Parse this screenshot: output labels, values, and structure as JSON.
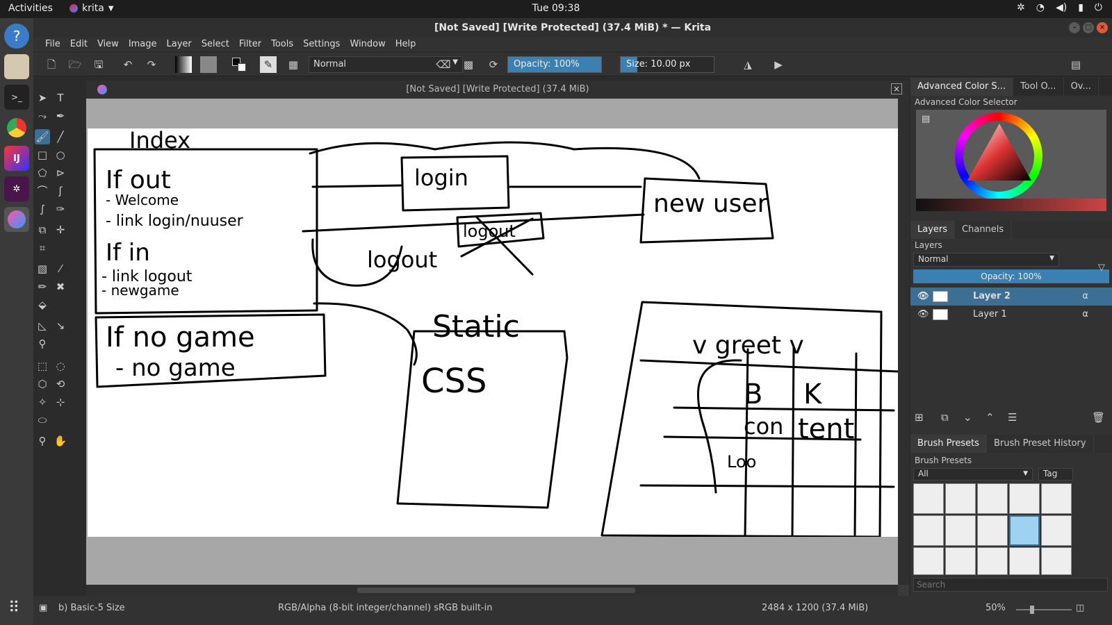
{
  "topbar": {
    "activities": "Activities",
    "app": "krita",
    "clock": "Tue 09:38"
  },
  "window": {
    "title": "[Not Saved]  [Write Protected]  (37.4 MiB) * — Krita"
  },
  "menu": [
    "File",
    "Edit",
    "View",
    "Image",
    "Layer",
    "Select",
    "Filter",
    "Tools",
    "Settings",
    "Window",
    "Help"
  ],
  "toolbar": {
    "blend_mode": "Normal",
    "opacity": "Opacity:  100%",
    "size": "Size:  10.00 px",
    "opacity_value": 100
  },
  "document": {
    "title": "[Not Saved]  [Write Protected]  (37.4 MiB)",
    "sketch_text": [
      "Index",
      "If out",
      "- Welcome",
      "- link login/nuuser",
      "If in",
      "- link logout",
      "- newgame",
      "login",
      "new user",
      "logout",
      "logout",
      "If no game",
      "- no game",
      "Static",
      "CSS",
      "v greet v",
      "B",
      "K",
      "con",
      "tent",
      "Loo"
    ]
  },
  "right_panel": {
    "top_tabs": [
      "Advanced Color S...",
      "Tool O...",
      "Ov..."
    ],
    "color_selector_title": "Advanced Color Selector",
    "layer_tabs": [
      "Layers",
      "Channels"
    ],
    "layers_title": "Layers",
    "layer_blend": "Normal",
    "layer_opacity": "Opacity:  100%",
    "layers": [
      {
        "name": "Layer 2",
        "selected": true
      },
      {
        "name": "Layer 1",
        "selected": false
      }
    ],
    "brush_tabs": [
      "Brush Presets",
      "Brush Preset History"
    ],
    "brush_title": "Brush Presets",
    "brush_filter": "All",
    "tag_label": "Tag",
    "search_placeholder": "Search"
  },
  "status": {
    "brush": "b) Basic-5 Size",
    "colorspace": "RGB/Alpha (8-bit integer/channel)  sRGB built-in",
    "dims": "2484 x 1200 (37.4 MiB)",
    "zoom": "50%"
  },
  "colors": {
    "accent": "#3d6f95",
    "panel": "#323232",
    "dark": "#1d1d1d"
  }
}
